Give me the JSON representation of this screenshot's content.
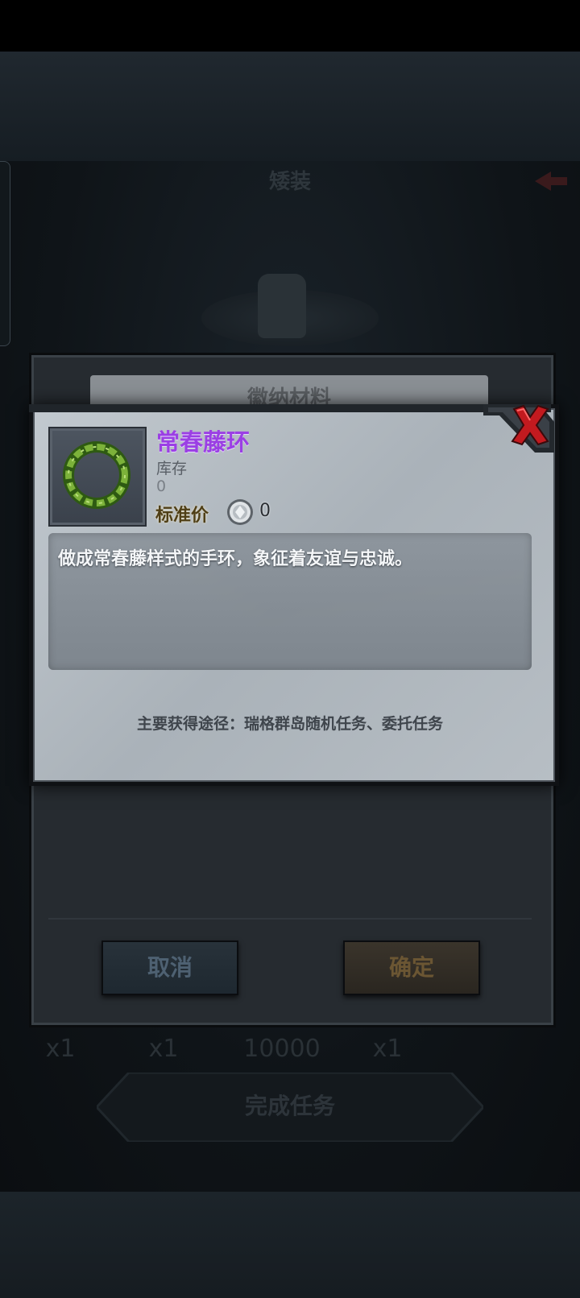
{
  "background": {
    "scene_title": "矮装",
    "quantities": [
      "x1",
      "x1",
      "10000",
      "x1"
    ],
    "complete_button_label": "完成任务"
  },
  "submit_dialog": {
    "title": "徽纳材料",
    "cancel_label": "取消",
    "confirm_label": "确定"
  },
  "item_dialog": {
    "name": "常春藤环",
    "stock_label": "库存",
    "stock_value": "0",
    "price_label": "标准价",
    "price_value": "0",
    "description": "做成常春藤样式的手环，象征着友谊与忠诚。",
    "source": "主要获得途径：瑞格群岛随机任务、委托任务",
    "icons": [
      "wreath-icon",
      "coin-icon",
      "close-icon"
    ],
    "colors": {
      "name": "#9b3fe4",
      "close": "#c21a1f"
    }
  }
}
